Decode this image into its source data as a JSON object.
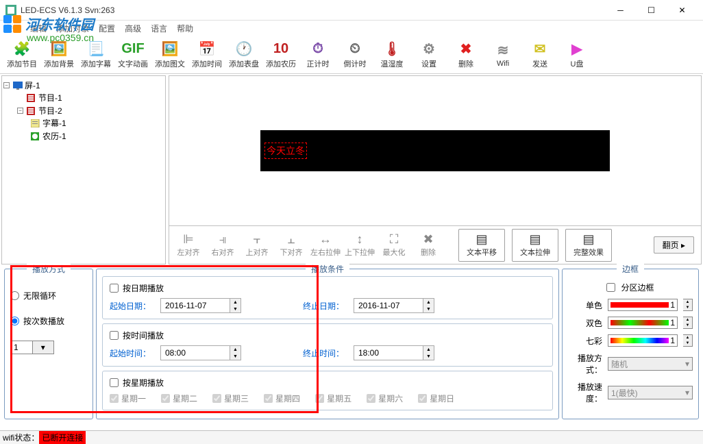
{
  "window": {
    "title": "LED-ECS V6.1.3 Svn:263"
  },
  "watermark": {
    "text": "河东软件园",
    "url": "www.pc0359.cn"
  },
  "menu": [
    "文件",
    "编辑",
    "添加对象",
    "配置",
    "高级",
    "语言",
    "帮助"
  ],
  "toolbar": [
    {
      "label": "添加节目",
      "icon": "🧩",
      "color": "#1e90ff"
    },
    {
      "label": "添加背景",
      "icon": "🖼️",
      "color": "#2aa02a"
    },
    {
      "label": "添加字幕",
      "icon": "📃",
      "color": "#1e90ff"
    },
    {
      "label": "文字动画",
      "icon": "GIF",
      "color": "#2aa02a"
    },
    {
      "label": "添加图文",
      "icon": "🖼️",
      "color": "#4a6fa8"
    },
    {
      "label": "添加时间",
      "icon": "📅",
      "color": "#1e90ff"
    },
    {
      "label": "添加表盘",
      "icon": "🕐",
      "color": "#d08820"
    },
    {
      "label": "添加农历",
      "icon": "10",
      "color": "#c02020"
    },
    {
      "label": "正计时",
      "icon": "⏱",
      "color": "#7a4aa8"
    },
    {
      "label": "倒计时",
      "icon": "⏲",
      "color": "#666"
    },
    {
      "label": "温湿度",
      "icon": "🌡",
      "color": "#c02020"
    },
    {
      "label": "设置",
      "icon": "⚙",
      "color": "#888"
    },
    {
      "label": "删除",
      "icon": "✖",
      "color": "#e02020"
    },
    {
      "label": "Wifi",
      "icon": "≋",
      "color": "#888"
    },
    {
      "label": "发送",
      "icon": "✉",
      "color": "#d0c020"
    },
    {
      "label": "U盘",
      "icon": "▶",
      "color": "#e040d0"
    }
  ],
  "tree": {
    "root": "屏-1",
    "n1": "节目-1",
    "n2": "节目-2",
    "c1": "字幕-1",
    "c2": "农历-1"
  },
  "led_text": "今天立冬",
  "midtools": [
    {
      "label": "左对齐",
      "icon": "⊫"
    },
    {
      "label": "右对齐",
      "icon": "⫣"
    },
    {
      "label": "上对齐",
      "icon": "⫟"
    },
    {
      "label": "下对齐",
      "icon": "⫠"
    },
    {
      "label": "左右拉伸",
      "icon": "↔"
    },
    {
      "label": "上下拉伸",
      "icon": "↕"
    },
    {
      "label": "最大化",
      "icon": "⛶"
    },
    {
      "label": "删除",
      "icon": "✖"
    }
  ],
  "midtools_big": [
    "文本平移",
    "文本拉伸",
    "完整效果"
  ],
  "page_btn": "翻页",
  "panels": {
    "play_mode": {
      "title": "播放方式",
      "opt1": "无限循环",
      "opt2": "按次数播放",
      "count": "1"
    },
    "play_cond": {
      "title": "播放条件",
      "by_date": "按日期播放",
      "start_date_lbl": "起始日期：",
      "start_date": "2016-11-07",
      "end_date_lbl": "终止日期：",
      "end_date": "2016-11-07",
      "by_time": "按时间播放",
      "start_time_lbl": "起始时间：",
      "start_time": "08:00",
      "end_time_lbl": "终止时间：",
      "end_time": "18:00",
      "by_week": "按星期播放",
      "weekdays": [
        "星期一",
        "星期二",
        "星期三",
        "星期四",
        "星期五",
        "星期六",
        "星期日"
      ]
    },
    "border": {
      "title": "边框",
      "chk": "分区边框",
      "single": "单色",
      "double": "双色",
      "colorful": "七彩",
      "num": "1",
      "style_lbl": "播放方式：",
      "style_val": "随机",
      "speed_lbl": "播放速度：",
      "speed_val": "1(最快)"
    }
  },
  "status": {
    "label": "wifi状态：",
    "value": "已断开连接"
  }
}
